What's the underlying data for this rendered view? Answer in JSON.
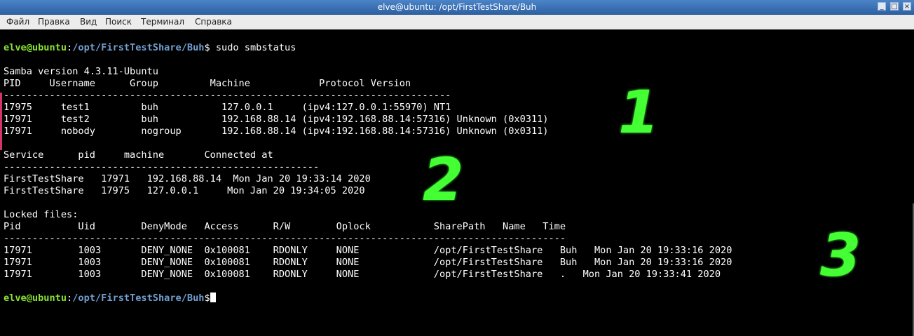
{
  "window": {
    "title": "elve@ubuntu: /opt/FirstTestShare/Buh",
    "min": "_",
    "max": "□",
    "close": "×"
  },
  "menu": [
    "Файл",
    "Правка",
    "Вид",
    "Поиск",
    "Терминал",
    "Справка"
  ],
  "prompt": {
    "user": "elve@ubuntu",
    "colon": ":",
    "path": "/opt/FirstTestShare/Buh",
    "dollar": "$",
    "command": " sudo smbstatus"
  },
  "output": [
    "",
    "Samba version 4.3.11-Ubuntu",
    "PID     Username      Group         Machine            Protocol Version",
    "------------------------------------------------------------------------------",
    "17975     test1         buh           127.0.0.1     (ipv4:127.0.0.1:55970) NT1",
    "17971     test2         buh           192.168.88.14 (ipv4:192.168.88.14:57316) Unknown (0x0311)",
    "17971     nobody        nogroup       192.168.88.14 (ipv4:192.168.88.14:57316) Unknown (0x0311)",
    "",
    "Service      pid     machine       Connected at",
    "-------------------------------------------------------",
    "FirstTestShare   17971   192.168.88.14  Mon Jan 20 19:33:14 2020",
    "FirstTestShare   17975   127.0.0.1     Mon Jan 20 19:34:05 2020",
    "",
    "Locked files:",
    "Pid          Uid        DenyMode   Access      R/W        Oplock           SharePath   Name   Time",
    "--------------------------------------------------------------------------------------------------",
    "17971        1003       DENY_NONE  0x100081    RDONLY     NONE             /opt/FirstTestShare   Buh   Mon Jan 20 19:33:16 2020",
    "17971        1003       DENY_NONE  0x100081    RDONLY     NONE             /opt/FirstTestShare   Buh   Mon Jan 20 19:33:16 2020",
    "17971        1003       DENY_NONE  0x100081    RDONLY     NONE             /opt/FirstTestShare   .   Mon Jan 20 19:33:41 2020",
    ""
  ],
  "annotations": [
    "1",
    "2",
    "3"
  ],
  "colors": {
    "prompt_user": "#8ae234",
    "prompt_path": "#729fcf",
    "annotation": "#44ff33",
    "titlebar": "#3a70b5"
  }
}
